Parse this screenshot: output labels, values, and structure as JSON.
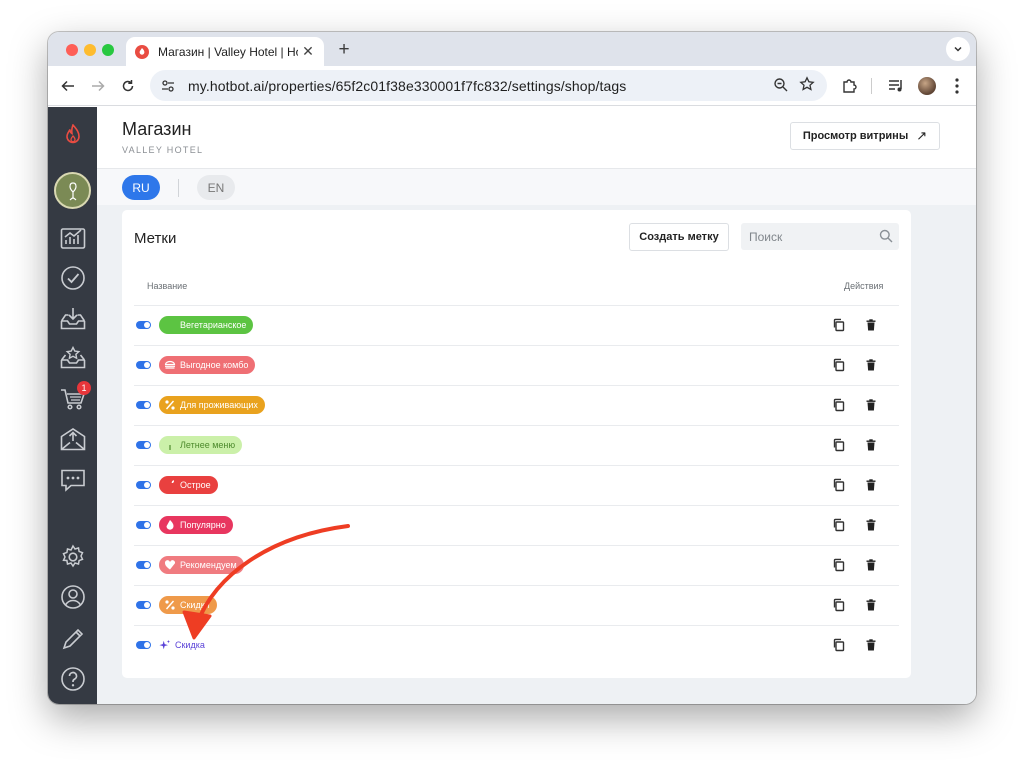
{
  "browser": {
    "tab_title": "Магазин | Valley Hotel | Hotbot",
    "url": "my.hotbot.ai/properties/65f2c01f38e330001f7fc832/settings/shop/tags"
  },
  "header": {
    "title": "Магазин",
    "subtitle": "VALLEY HOTEL",
    "storefront_label": "Просмотр витрины",
    "storefront_arrow": "↗"
  },
  "languages": [
    {
      "code": "RU",
      "active": true
    },
    {
      "code": "EN",
      "active": false
    }
  ],
  "sidebar": {
    "cart_badge": "1"
  },
  "tags_card": {
    "title": "Метки",
    "create_label": "Создать метку",
    "search_placeholder": "Поиск",
    "col_name": "Название",
    "col_actions": "Действия",
    "rows": [
      {
        "label": "Вегетарианское",
        "icon": "leaf-icon",
        "color": "#5cc442",
        "text_color": "#ffffff"
      },
      {
        "label": "Выгодное комбо",
        "icon": "burger-icon",
        "color": "#ef6f74",
        "text_color": "#ffffff"
      },
      {
        "label": "Для проживающих",
        "icon": "percent-icon",
        "color": "#e9a21e",
        "text_color": "#ffffff"
      },
      {
        "label": "Летнее меню",
        "icon": "sprout-icon",
        "color": "#cbf0a9",
        "text_color": "#4d8a2c"
      },
      {
        "label": "Острое",
        "icon": "pepper-icon",
        "color": "#e9403f",
        "text_color": "#ffffff"
      },
      {
        "label": "Популярно",
        "icon": "flame-icon",
        "color": "#e8365f",
        "text_color": "#ffffff"
      },
      {
        "label": "Рекомендуем",
        "icon": "heart-icon",
        "color": "#f07b80",
        "text_color": "#ffffff"
      },
      {
        "label": "Скидки",
        "icon": "percent-icon",
        "color": "#ef9a4a",
        "text_color": "#ffffff"
      },
      {
        "label": "Скидка",
        "icon": "sparkle-icon",
        "color": "#ffffff",
        "text_color": "#5b43d8"
      }
    ]
  },
  "colors": {
    "accent": "#2e77ea",
    "sidebar_bg": "#353a43",
    "annotation_arrow": "#ee3d23"
  }
}
